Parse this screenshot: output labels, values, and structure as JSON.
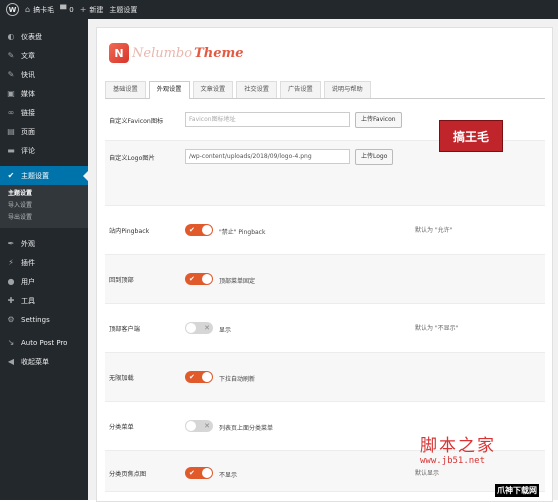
{
  "adminbar": {
    "site_name": "搞卡毛",
    "comments": "0",
    "new_label": "新建",
    "page_label": "主题设置"
  },
  "sidebar": {
    "items": [
      {
        "label": "仪表盘",
        "icon": "dashboard-icon"
      },
      {
        "label": "文章",
        "icon": "pin-icon"
      },
      {
        "label": "快讯",
        "icon": "pin-icon"
      },
      {
        "label": "媒体",
        "icon": "media-icon"
      },
      {
        "label": "链接",
        "icon": "link-icon"
      },
      {
        "label": "页面",
        "icon": "page-icon"
      },
      {
        "label": "评论",
        "icon": "comment-icon"
      },
      {
        "label": "主题设置",
        "icon": "wrench-icon"
      }
    ],
    "submenu": [
      "主题设置",
      "导入设置",
      "导出设置"
    ],
    "items2": [
      {
        "label": "外观",
        "icon": "brush-icon"
      },
      {
        "label": "插件",
        "icon": "plugin-icon"
      },
      {
        "label": "用户",
        "icon": "user-icon"
      },
      {
        "label": "工具",
        "icon": "tool-icon"
      },
      {
        "label": "Settings",
        "icon": "settings-icon"
      },
      {
        "label": "Auto Post Pro",
        "icon": "arrow-icon"
      },
      {
        "label": "收起菜单",
        "icon": "collapse-icon"
      }
    ]
  },
  "theme": {
    "logo_part1": "Nelumbo",
    "logo_part2": "Theme"
  },
  "tabs": [
    "基础设置",
    "外观设置",
    "文章设置",
    "社交设置",
    "广告设置",
    "说明与帮助"
  ],
  "active_tab": 1,
  "form": {
    "favicon": {
      "label": "自定义Favicon图标",
      "placeholder": "Favicon图标地址",
      "button": "上传Favicon"
    },
    "logo": {
      "label": "自定义Logo图片",
      "value": "/wp-content/uploads/2018/09/logo-4.png",
      "button": "上传Logo",
      "preview_text": "搞王毛"
    },
    "toggles": [
      {
        "label": "站内Pingback",
        "state": "on",
        "desc": "\"禁止\" Pingback",
        "note": "默认为 \"允许\""
      },
      {
        "label": "回到顶部",
        "state": "on",
        "desc": "顶部菜单固定",
        "note": ""
      },
      {
        "label": "顶部客户端",
        "state": "off",
        "desc": "显示",
        "note": "默认为 \"不显示\""
      },
      {
        "label": "无限加载",
        "state": "on",
        "desc": "下拉自动刷新",
        "note": ""
      },
      {
        "label": "分类菜单",
        "state": "off",
        "desc": "列表页上面分类菜单",
        "note": ""
      },
      {
        "label": "分类页焦点图",
        "state": "on",
        "desc": "不显示",
        "note": "默认显示"
      }
    ]
  },
  "watermark": {
    "line1": "脚本之家",
    "line2": "www.jb51.net",
    "line3": "爪神下载网"
  },
  "colors": {
    "accent": "#0073aa",
    "toggle_on": "#e05a2c",
    "toggle_off": "#d6d6d6",
    "sidebar_bg": "#23282d"
  }
}
